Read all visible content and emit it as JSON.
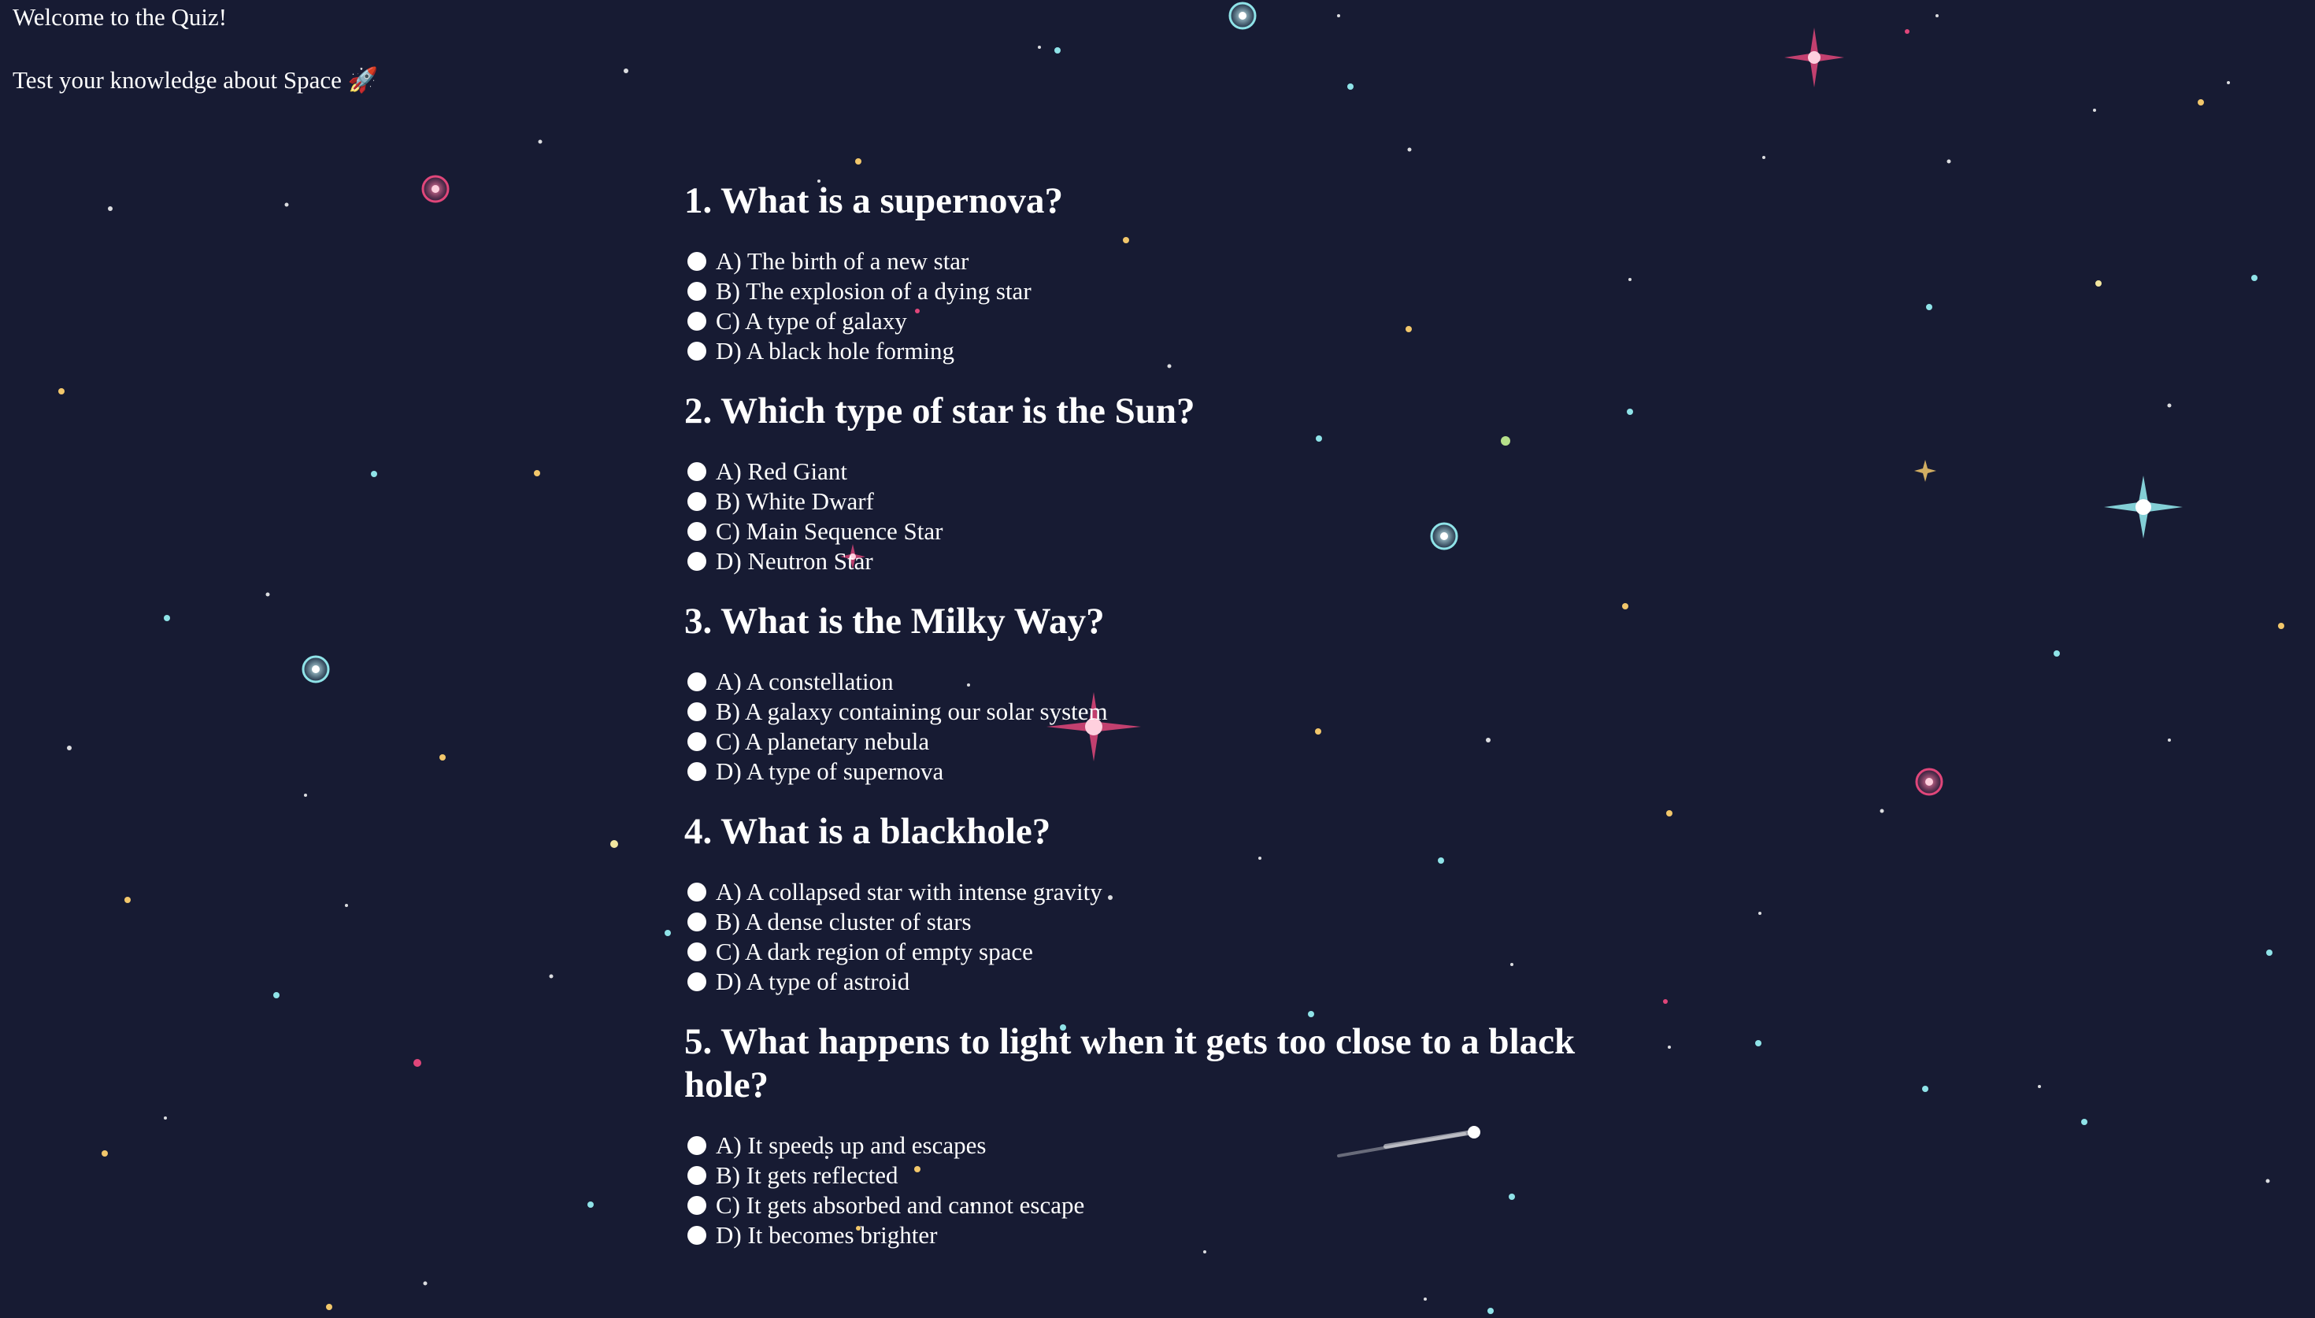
{
  "header": {
    "title": "Welcome to the Quiz!",
    "subtitle": "Test your knowledge about Space 🚀"
  },
  "quiz": {
    "questions": [
      {
        "title": "1. What is a supernova?",
        "options": [
          "A) The birth of a new star",
          "B) The explosion of a dying star",
          "C) A type of galaxy",
          "D) A black hole forming"
        ]
      },
      {
        "title": "2. Which type of star is the Sun?",
        "options": [
          "A) Red Giant",
          "B) White Dwarf",
          "C) Main Sequence Star",
          "D) Neutron Star"
        ]
      },
      {
        "title": "3. What is the Milky Way?",
        "options": [
          "A) A constellation",
          "B) A galaxy containing our solar system",
          "C) A planetary nebula",
          "D) A type of supernova"
        ]
      },
      {
        "title": "4. What is a blackhole?",
        "options": [
          "A) A collapsed star with intense gravity",
          "B) A dense cluster of stars",
          "C) A dark region of empty space",
          "D) A type of astroid"
        ]
      },
      {
        "title": "5. What happens to light when it gets too close to a black hole?",
        "options": [
          "A) It speeds up and escapes",
          "B) It gets reflected",
          "C) It gets absorbed and cannot escape",
          "D) It becomes brighter"
        ]
      }
    ]
  },
  "colors": {
    "background": "#171b33",
    "text": "#ffffff",
    "star_pink": "#e0467a",
    "star_cyan": "#8fe3e8",
    "star_yellow": "#f2c76b"
  }
}
